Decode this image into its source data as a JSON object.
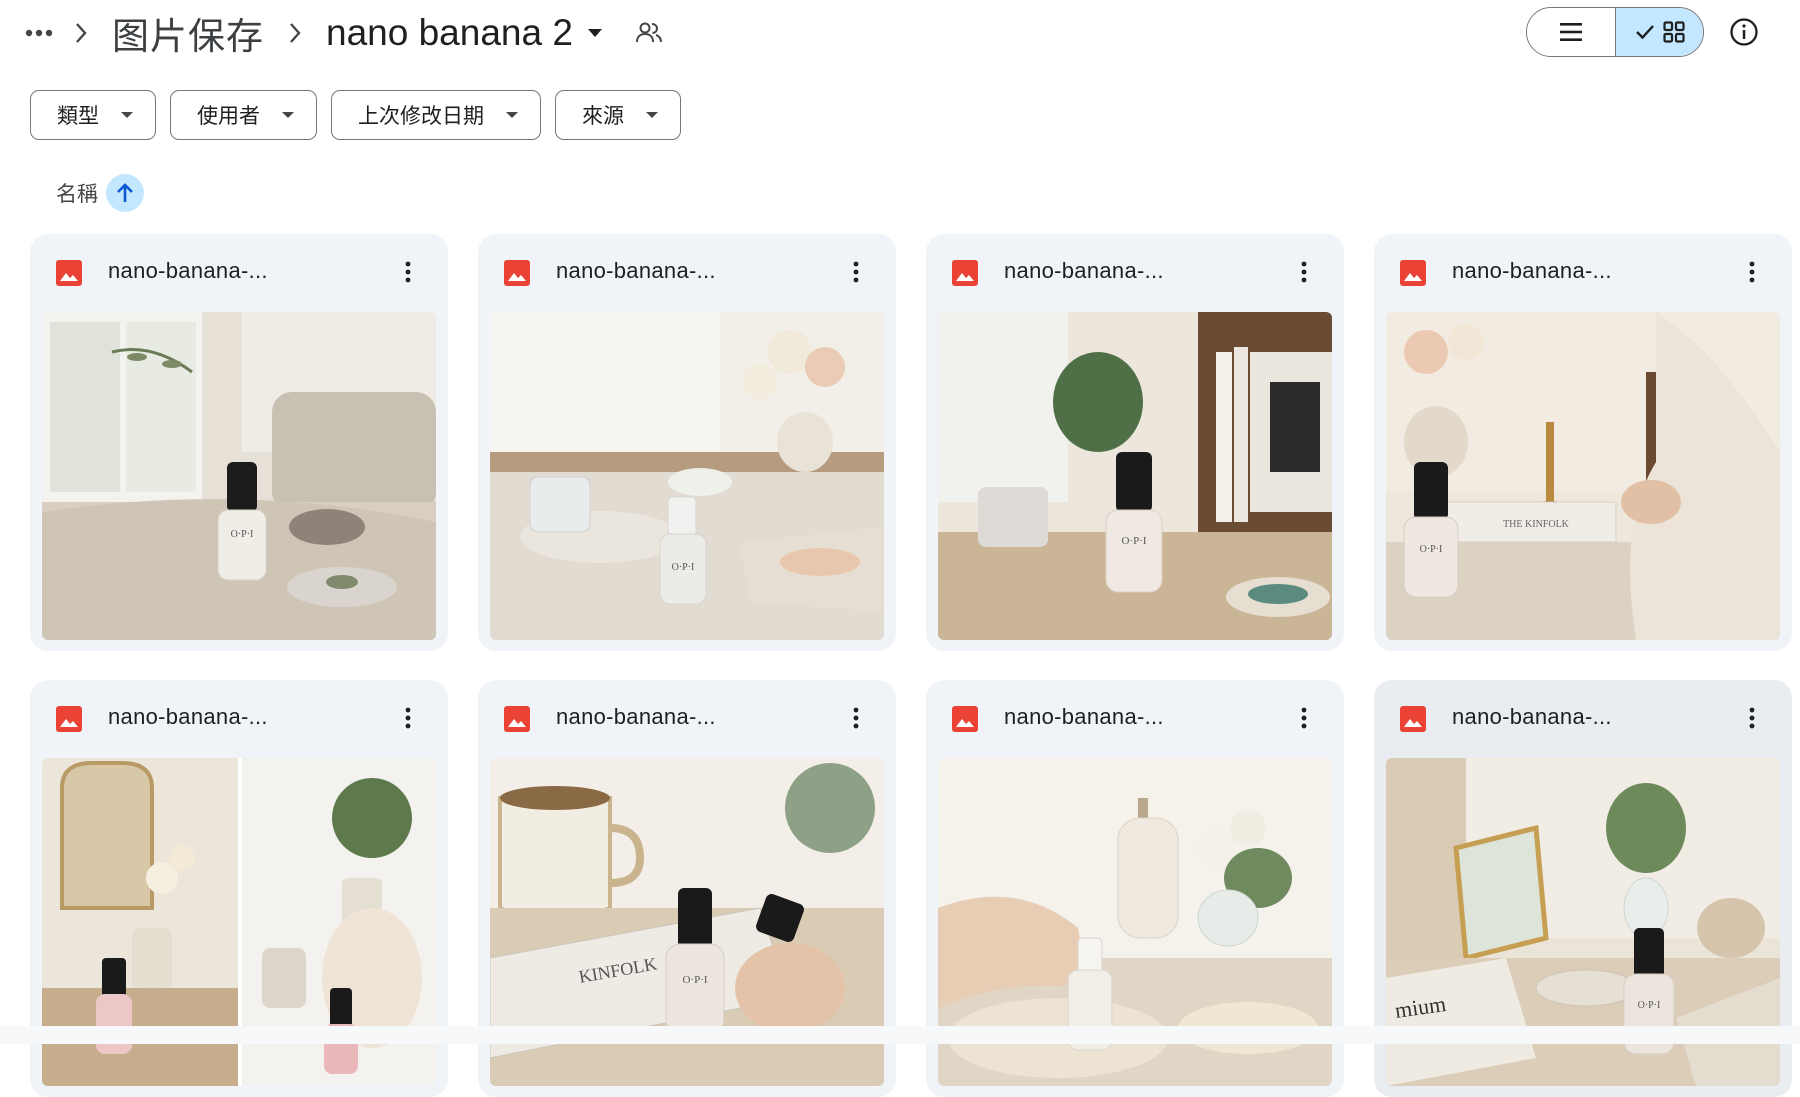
{
  "breadcrumb": {
    "more_label": "…",
    "parent": "图片保存",
    "current": "nano banana 2"
  },
  "view": {
    "mode": "grid"
  },
  "filters": [
    {
      "label": "類型"
    },
    {
      "label": "使用者"
    },
    {
      "label": "上次修改日期"
    },
    {
      "label": "來源"
    }
  ],
  "sort": {
    "label": "名稱",
    "direction": "ascending"
  },
  "files": [
    {
      "name": "nano-banana-..."
    },
    {
      "name": "nano-banana-..."
    },
    {
      "name": "nano-banana-..."
    },
    {
      "name": "nano-banana-..."
    },
    {
      "name": "nano-banana-..."
    },
    {
      "name": "nano-banana-..."
    },
    {
      "name": "nano-banana-..."
    },
    {
      "name": "nano-banana-..."
    }
  ],
  "colors": {
    "accent": "#c2e7ff",
    "card_bg": "#f0f4f9",
    "image_icon": "#ea4335",
    "text": "#1f1f1f"
  },
  "icons": {
    "more": "more-horiz-icon",
    "separator": "chevron-right-icon",
    "dropdown": "caret-down-icon",
    "shared": "people-icon",
    "list_view": "list-view-icon",
    "grid_view": "grid-view-icon",
    "check": "check-icon",
    "info": "info-icon",
    "sort_arrow": "arrow-up-icon",
    "file_type": "image-file-icon",
    "file_menu": "more-vert-icon"
  }
}
